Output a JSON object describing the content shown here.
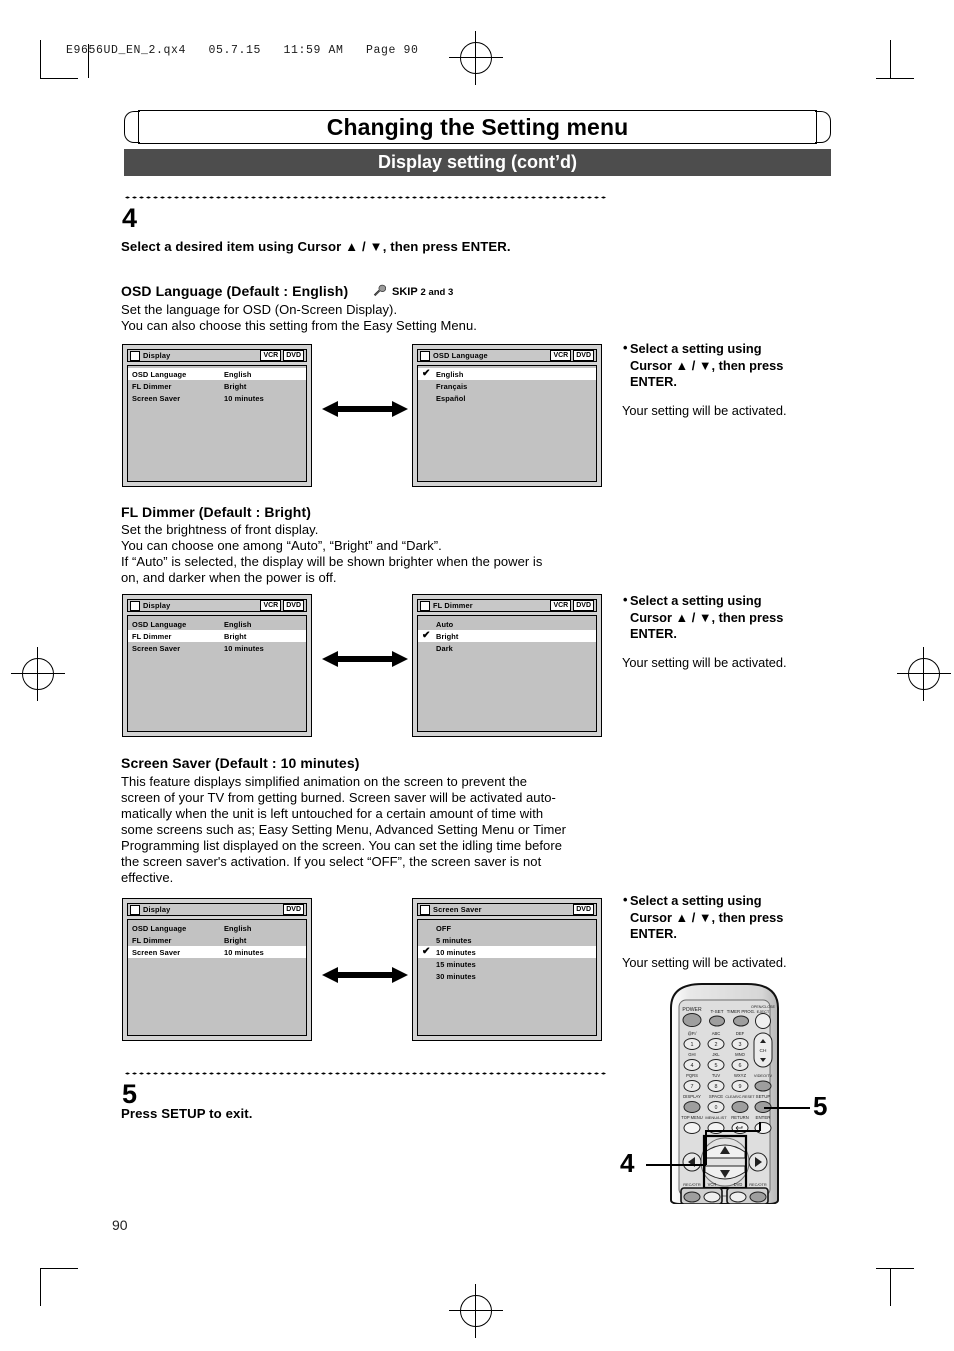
{
  "print_slug": "E9656UD_EN_2.qx4   05.7.15   11:59 AM   Page 90",
  "banner": {
    "title": "Changing the Setting menu",
    "subtitle": "Display setting (cont’d)"
  },
  "steps": [
    {
      "number": "4",
      "instruction": "Select a desired item using Cursor ▲ / ▼, then press ENTER."
    },
    {
      "number": "5",
      "instruction": "Press SETUP to exit."
    }
  ],
  "sections": [
    {
      "heading": "OSD Language (Default : English)",
      "skip_icon": "wrench-icon",
      "skip_label": "SKIP",
      "skip_detail": "2 and 3",
      "body_lines": [
        "Set the language for OSD (On-Screen Display).",
        "You can also choose this setting from the Easy Setting Menu."
      ]
    },
    {
      "heading": "FL Dimmer (Default : Bright)",
      "body_lines": [
        "Set the brightness of front display.",
        "You can choose one among “Auto”, “Bright” and “Dark”.",
        "If “Auto” is selected, the display will be shown brighter when the power is",
        "on, and darker when the power is off."
      ]
    },
    {
      "heading": "Screen Saver (Default : 10 minutes)",
      "body_lines": [
        "This feature displays simplified animation on the screen to prevent the",
        "screen of your TV from getting burned. Screen saver will be activated auto-",
        "matically when the unit is left untouched for a certain amount of time with",
        "some screens such as; Easy Setting Menu, Advanced Setting Menu or Timer",
        "Programming list displayed on the screen. You can set the idling time before",
        "the screen saver's activation. If you select “OFF”, the screen saver is not",
        "effective."
      ]
    }
  ],
  "osd_screens": {
    "display_osd": {
      "title": "Display",
      "badges": [
        "VCR",
        "DVD"
      ],
      "rows": [
        {
          "label": "OSD Language",
          "value": "English",
          "selected": true
        },
        {
          "label": "FL Dimmer",
          "value": "Bright",
          "selected": false
        },
        {
          "label": "Screen Saver",
          "value": "10 minutes",
          "selected": false
        }
      ]
    },
    "osd_language": {
      "title": "OSD Language",
      "badges": [
        "VCR",
        "DVD"
      ],
      "options": [
        {
          "label": "English",
          "checked": true,
          "selected": true
        },
        {
          "label": "Français",
          "checked": false,
          "selected": false
        },
        {
          "label": "Español",
          "checked": false,
          "selected": false
        }
      ]
    },
    "display_fl": {
      "title": "Display",
      "badges": [
        "VCR",
        "DVD"
      ],
      "rows": [
        {
          "label": "OSD Language",
          "value": "English",
          "selected": false
        },
        {
          "label": "FL Dimmer",
          "value": "Bright",
          "selected": true
        },
        {
          "label": "Screen Saver",
          "value": "10 minutes",
          "selected": false
        }
      ]
    },
    "fl_dimmer": {
      "title": "FL Dimmer",
      "badges": [
        "VCR",
        "DVD"
      ],
      "options": [
        {
          "label": "Auto",
          "checked": false,
          "selected": false
        },
        {
          "label": "Bright",
          "checked": true,
          "selected": true
        },
        {
          "label": "Dark",
          "checked": false,
          "selected": false
        }
      ]
    },
    "display_ss": {
      "title": "Display",
      "badges": [
        "DVD"
      ],
      "rows": [
        {
          "label": "OSD Language",
          "value": "English",
          "selected": false
        },
        {
          "label": "FL Dimmer",
          "value": "Bright",
          "selected": false
        },
        {
          "label": "Screen Saver",
          "value": "10 minutes",
          "selected": true
        }
      ]
    },
    "screen_saver": {
      "title": "Screen Saver",
      "badges": [
        "DVD"
      ],
      "options": [
        {
          "label": "OFF",
          "checked": false,
          "selected": false
        },
        {
          "label": "5 minutes",
          "checked": false,
          "selected": false
        },
        {
          "label": "10 minutes",
          "checked": true,
          "selected": true
        },
        {
          "label": "15 minutes",
          "checked": false,
          "selected": false
        },
        {
          "label": "30 minutes",
          "checked": false,
          "selected": false
        }
      ]
    }
  },
  "notes": [
    {
      "bullet_lines": [
        "Select a setting using",
        "Cursor ▲ / ▼, then press",
        "ENTER."
      ],
      "sub": "Your setting will be activated."
    },
    {
      "bullet_lines": [
        "Select a setting using",
        "Cursor ▲ / ▼, then press",
        "ENTER."
      ],
      "sub": "Your setting will be activated."
    },
    {
      "bullet_lines": [
        "Select a setting using",
        "Cursor ▲ / ▼, then press",
        "ENTER."
      ],
      "sub": "Your setting will be activated."
    }
  ],
  "remote": {
    "callouts": [
      {
        "number": "5",
        "target": "setup-button"
      },
      {
        "number": "4",
        "target": "cursor-enter-buttons"
      }
    ],
    "buttons": [
      {
        "label": "POWER"
      },
      {
        "label": "T-SET"
      },
      {
        "label": "TIMER PROG."
      },
      {
        "label": "OPEN/CLOSE",
        "sub": "EJECT"
      },
      {
        "label": "1",
        "sub": "@P./"
      },
      {
        "label": "2",
        "sub": "ABC"
      },
      {
        "label": "3",
        "sub": "DEF"
      },
      {
        "label": "CH"
      },
      {
        "label": "4",
        "sub": "GHI"
      },
      {
        "label": "5",
        "sub": "JKL"
      },
      {
        "label": "6",
        "sub": "MNO"
      },
      {
        "label": "7",
        "sub": "PQRS"
      },
      {
        "label": "8",
        "sub": "TUV"
      },
      {
        "label": "9",
        "sub": "WXYZ"
      },
      {
        "label": "VIDEO/TV"
      },
      {
        "label": "DISPLAY"
      },
      {
        "label": "0",
        "sub": "SPACE"
      },
      {
        "label": "CLEAR/C.RESET"
      },
      {
        "label": "SETUP"
      },
      {
        "label": "TOP MENU"
      },
      {
        "label": "MENU/LIST"
      },
      {
        "label": "RETURN"
      },
      {
        "label": "ENTER"
      },
      {
        "label": "REC/OTR"
      },
      {
        "label": "VCR"
      },
      {
        "label": "DVD"
      },
      {
        "label": "REC/OTR"
      }
    ]
  },
  "page_number": "90"
}
